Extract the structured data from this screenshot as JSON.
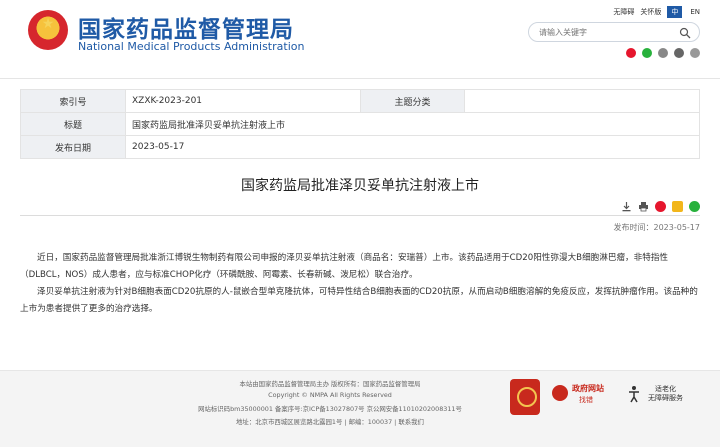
{
  "header": {
    "title_cn": "国家药品监督管理局",
    "title_en": "National Medical Products Administration",
    "toplinks": {
      "accessibility": "无障碍",
      "care": "关怀版",
      "lang_zh": "中",
      "lang_en": "EN"
    },
    "search": {
      "placeholder": "请输入关键字"
    },
    "share_icons": [
      "weibo-icon",
      "wechat-icon",
      "qq-icon",
      "email-icon",
      "close-icon"
    ]
  },
  "meta": {
    "index_label": "索引号",
    "index_value": "XZXK-2023-201",
    "category_label": "主题分类",
    "category_value": "",
    "title_label": "标题",
    "title_value": "国家药监局批准泽贝妥单抗注射液上市",
    "date_label": "发布日期",
    "date_value": "2023-05-17"
  },
  "article": {
    "title": "国家药监局批准泽贝妥单抗注射液上市",
    "publish_time": "发布时间：2023-05-17",
    "paragraphs": [
      "近日，国家药品监督管理局批准浙江博锐生物制药有限公司申报的泽贝妥单抗注射液（商品名：安瑞普）上市。该药品适用于CD20阳性弥漫大B细胞淋巴瘤，非特指性（DLBCL，NOS）成人患者，应与标准CHOP化疗（环磷酰胺、阿霉素、长春新碱、泼尼松）联合治疗。",
      "泽贝妥单抗注射液为针对B细胞表面CD20抗原的人-鼠嵌合型单克隆抗体，可特异性结合B细胞表面的CD20抗原，从而启动B细胞溶解的免疫反应，发挥抗肿瘤作用。该品种的上市为患者提供了更多的治疗选择。"
    ]
  },
  "footer": {
    "line1": "本站由国家药品监督管理局主办 版权所有：国家药品监督管理局",
    "line2": "Copyright © NMPA All Rights Reserved",
    "line3": "网站标识码bm35000001    备案序号:京ICP备13027807号    京公网安备11010202008311号",
    "line4": "地址：北京市西城区展览路北露园1号 | 邮编：100037 | 联系我们",
    "gov_site_title": "政府网站",
    "gov_site_sub": "找错",
    "accessibility_title": "适老化",
    "accessibility_sub": "无障碍服务"
  },
  "colors": {
    "brand_blue": "#1f5aa6",
    "brand_red": "#c8291d"
  }
}
